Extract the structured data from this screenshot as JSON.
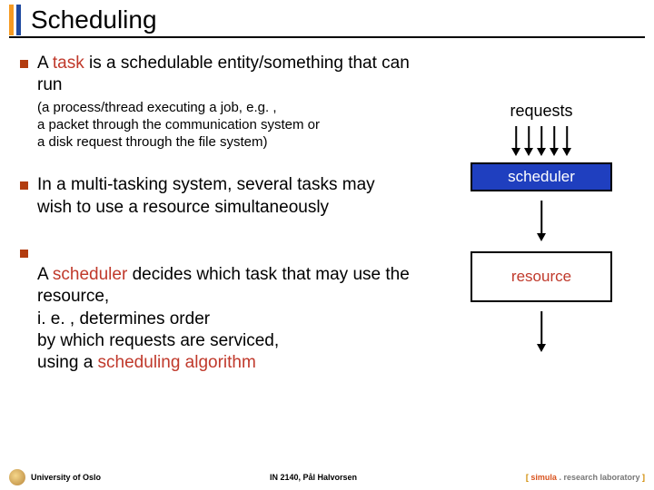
{
  "title": "Scheduling",
  "bullets": [
    {
      "main_pre": "A ",
      "main_hl": "task",
      "main_post": " is a schedulable entity/something that can run",
      "sub": "(a process/thread executing a job, e.g. ,\na packet through the communication system or\na disk request through the file system)"
    },
    {
      "main": "In a multi-tasking system, several tasks may wish to use a resource simultaneously"
    },
    {
      "main_pre": "A ",
      "main_hl": "scheduler",
      "main_post": " decides which task that may use the resource,\ni. e. , determines order\nby which requests are serviced,\nusing a ",
      "main_hl2": "scheduling algorithm"
    }
  ],
  "diagram": {
    "requests": "requests",
    "scheduler": "scheduler",
    "resource": "resource"
  },
  "footer": {
    "left": "University of Oslo",
    "mid": "IN 2140,  Pål Halvorsen",
    "right_open": "[ ",
    "right_sim": "simula",
    "right_dot": " . ",
    "right_lab": "research laboratory",
    "right_close": " ]"
  }
}
